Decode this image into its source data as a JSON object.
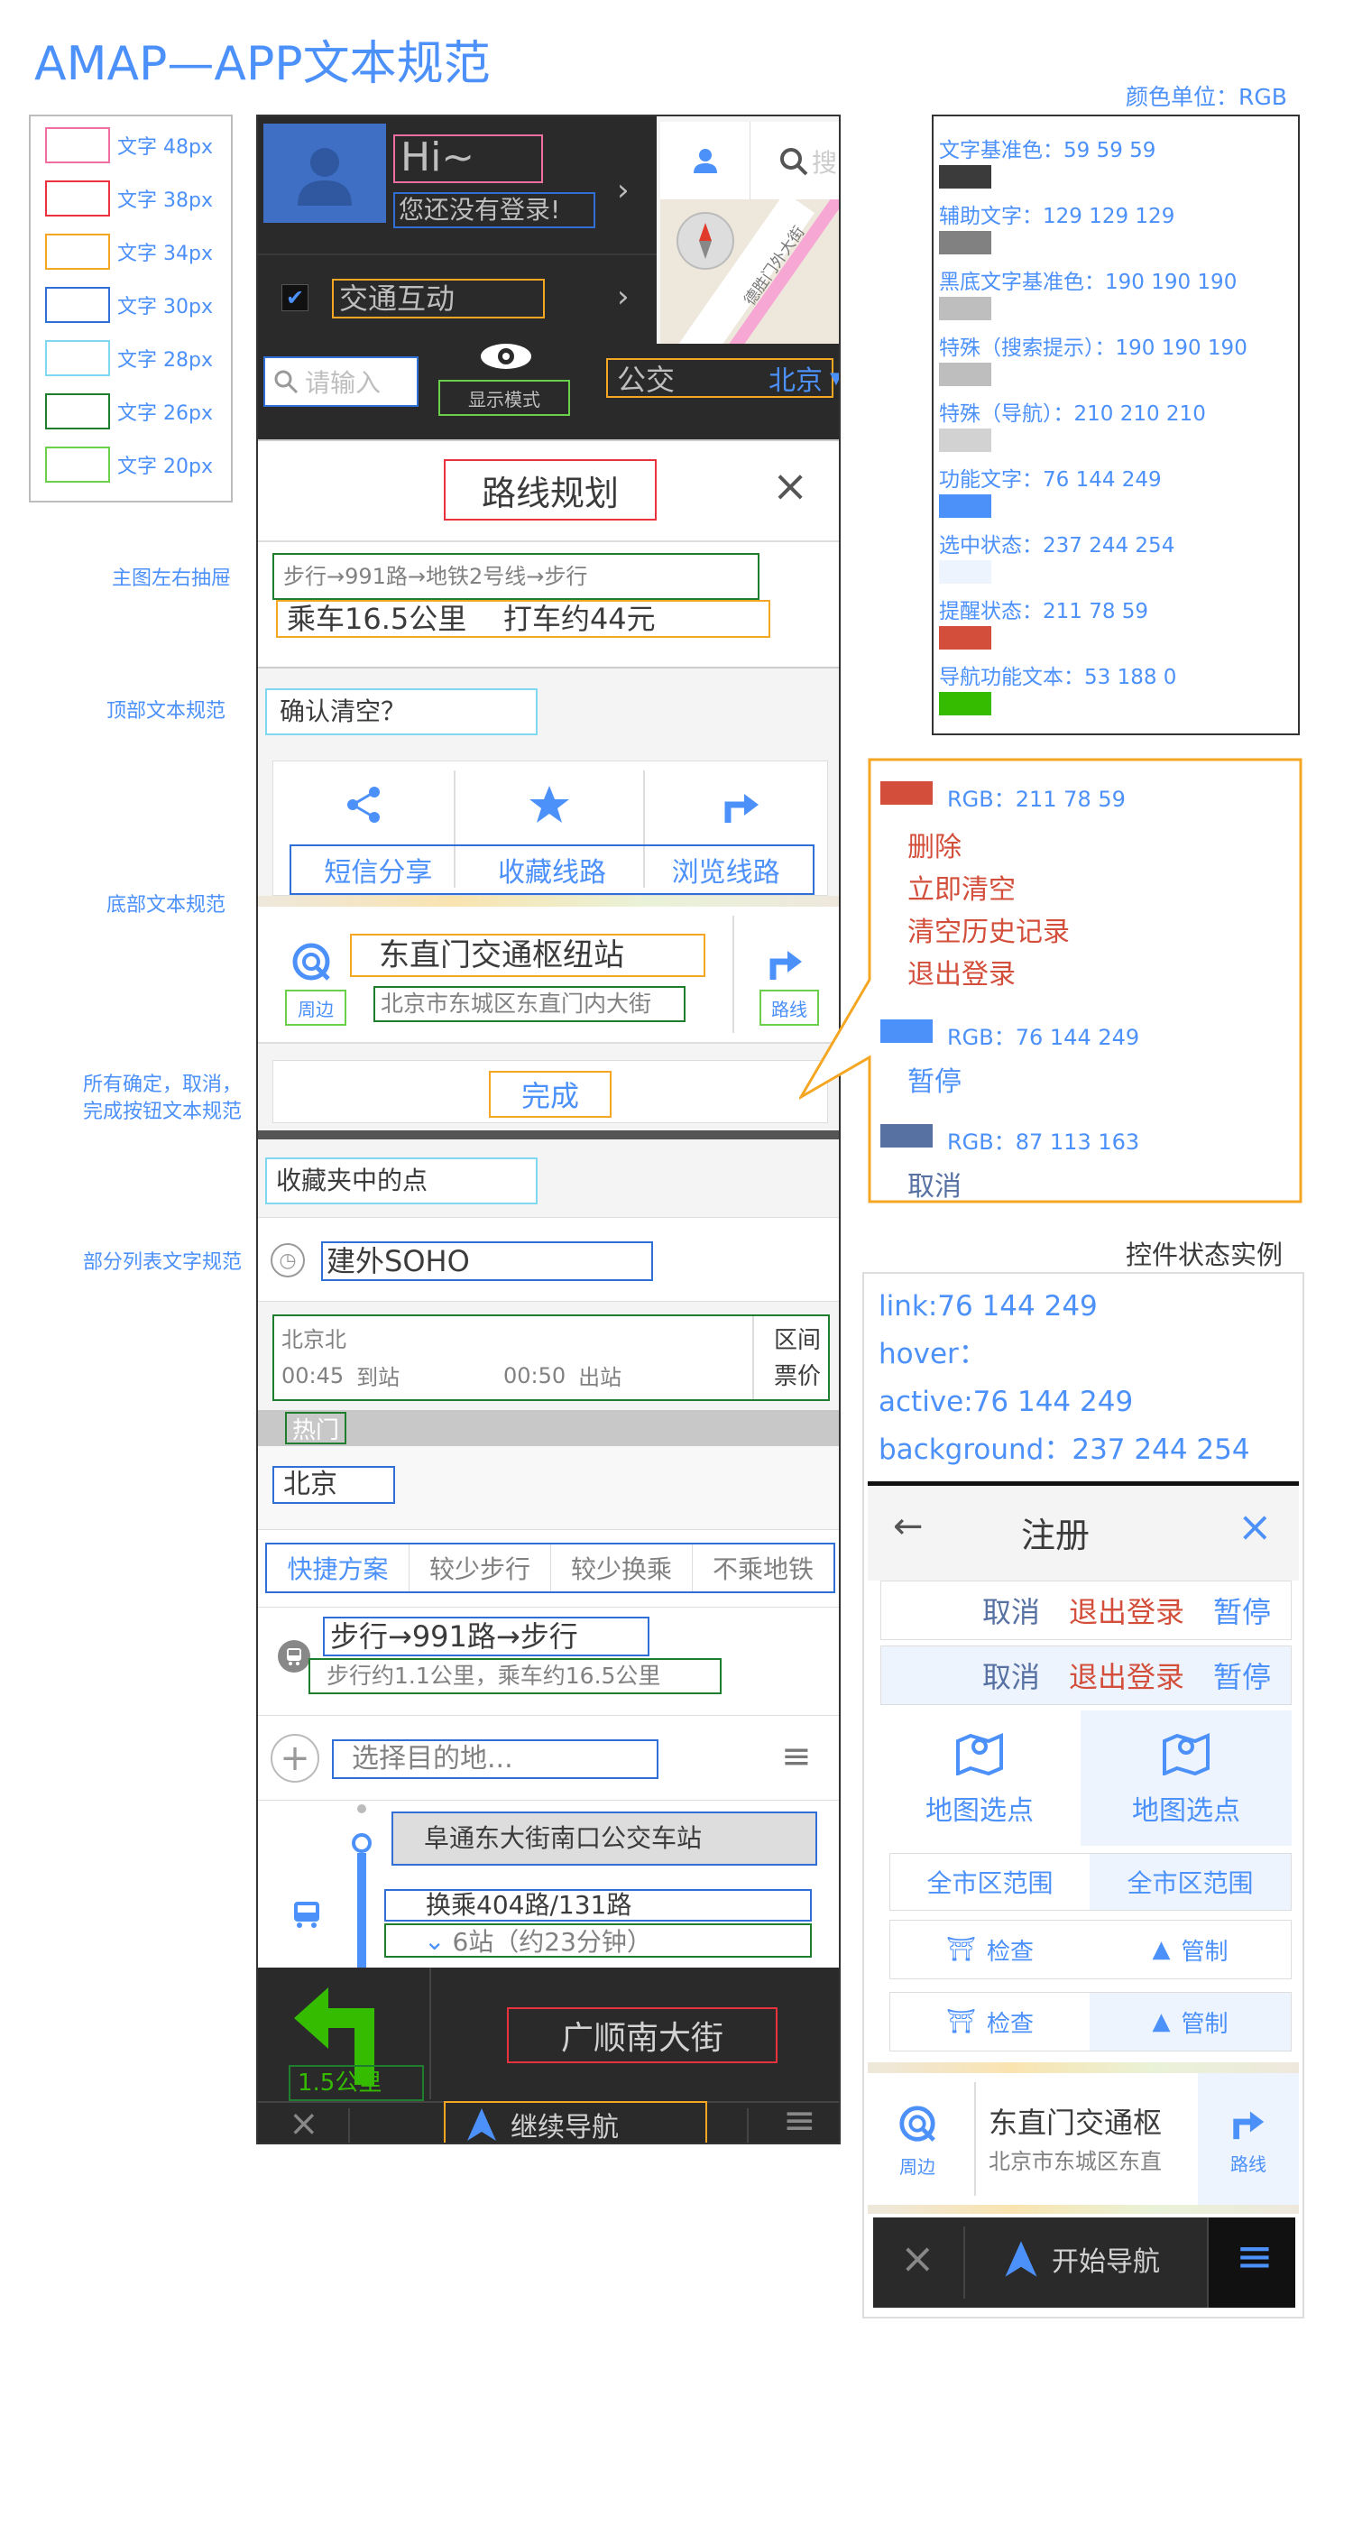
{
  "header": {
    "title": "AMAP—APP文本规范",
    "color_unit": "颜色单位：RGB"
  },
  "legend": [
    {
      "label": "文字 48px",
      "color": "#f06ea0"
    },
    {
      "label": "文字 38px",
      "color": "#e8323c"
    },
    {
      "label": "文字 34px",
      "color": "#f5a623"
    },
    {
      "label": "文字 30px",
      "color": "#2f6fd6"
    },
    {
      "label": "文字 28px",
      "color": "#7fd8f0"
    },
    {
      "label": "文字 26px",
      "color": "#1e7e2e"
    },
    {
      "label": "文字 20px",
      "color": "#6ad04a"
    }
  ],
  "annotations": {
    "drawer": "主图左右抽屉",
    "top_text": "顶部文本规范",
    "bottom_text": "底部文本规范",
    "confirm_buttons": "所有确定，取消，完成按钮文本规范",
    "list_text": "部分列表文字规范"
  },
  "colors": [
    {
      "label": "文字基准色：59 59 59",
      "hex": "#3b3b3b"
    },
    {
      "label": "辅助文字：129 129 129",
      "hex": "#818181"
    },
    {
      "label": "黑底文字基准色：190 190 190",
      "hex": "#bebebe"
    },
    {
      "label": "特殊（搜索提示）：190 190 190",
      "hex": "#bebebe"
    },
    {
      "label": "特殊（导航）：210 210 210",
      "hex": "#d2d2d2"
    },
    {
      "label": "功能文字：76 144 249",
      "hex": "#4c90f9"
    },
    {
      "label": "选中状态：237 244 254",
      "hex": "#edf4fe"
    },
    {
      "label": "提醒状态：211 78 59",
      "hex": "#d34e3b"
    },
    {
      "label": "导航功能文本：53 188 0",
      "hex": "#35bc00"
    }
  ],
  "callout": {
    "red": {
      "label": "RGB：211 78 59",
      "hex": "#d34e3b",
      "items": [
        "删除",
        "立即清空",
        "清空历史记录",
        "退出登录"
      ]
    },
    "blue": {
      "label": "RGB：76 144 249",
      "hex": "#4c90f9",
      "items": [
        "暂停"
      ]
    },
    "navy": {
      "label": "RGB：87 113 163",
      "hex": "#5771a3",
      "items": [
        "取消"
      ]
    }
  },
  "state_example": {
    "title": "控件状态实例",
    "lines": [
      "link:76 144 249",
      "hover：",
      "active:76 144 249",
      "background：237 244 254"
    ]
  },
  "phone": {
    "drawer": {
      "greeting": "Hi~",
      "login_hint": "您还没有登录!",
      "traffic": "交通互动",
      "search_cut": "搜",
      "road_label": "德胜门外大街"
    },
    "search_row": {
      "placeholder": "请输入",
      "display_mode": "显示模式",
      "mode": "公交",
      "city": "北京"
    },
    "route_plan": {
      "title": "路线规划",
      "route_text": "步行→991路→地铁2号线→步行",
      "summary": "乘车16.5公里    打车约44元"
    },
    "confirm_clear": "确认清空？",
    "actions": [
      "短信分享",
      "收藏线路",
      "浏览线路"
    ],
    "poi": {
      "name": "东直门交通枢纽站",
      "address": "北京市东城区东直门内大街",
      "nearby": "周边",
      "route": "路线"
    },
    "done": "完成",
    "favorites": "收藏夹中的点",
    "history_item": "建外SOHO",
    "train": {
      "station": "北京北",
      "arrive_time": "00:45",
      "arrive_label": "到站",
      "depart_time": "00:50",
      "depart_label": "出站",
      "section_1": "区间",
      "section_2": "票价"
    },
    "hot": "热门",
    "city": "北京",
    "tabs": [
      "快捷方案",
      "较少步行",
      "较少换乘",
      "不乘地铁"
    ],
    "route_option": {
      "title": "步行→991路→步行",
      "detail": "步行约1.1公里，乘车约16.5公里"
    },
    "destination_placeholder": "选择目的地...",
    "bus": {
      "stop": "阜通东大街南口公交车站",
      "transfer": "换乘404路/131路",
      "stops": "6站（约23分钟）"
    },
    "nav": {
      "distance": "1.5公里",
      "road": "广顺南大街",
      "continue": "继续导航"
    }
  },
  "right_demo": {
    "title": "注册",
    "row1": [
      "取消",
      "退出登录",
      "暂停"
    ],
    "row2": [
      "取消",
      "退出登录",
      "暂停"
    ],
    "map_pick": [
      "地图选点",
      "地图选点"
    ],
    "citywide": [
      "全市区范围",
      "全市区范围"
    ],
    "check_control_1": [
      "检查",
      "管制"
    ],
    "check_control_2": [
      "检查",
      "管制"
    ],
    "poi": {
      "name": "东直门交通枢",
      "address": "北京市东城区东直",
      "nearby": "周边",
      "route": "路线"
    },
    "start_nav": "开始导航"
  }
}
